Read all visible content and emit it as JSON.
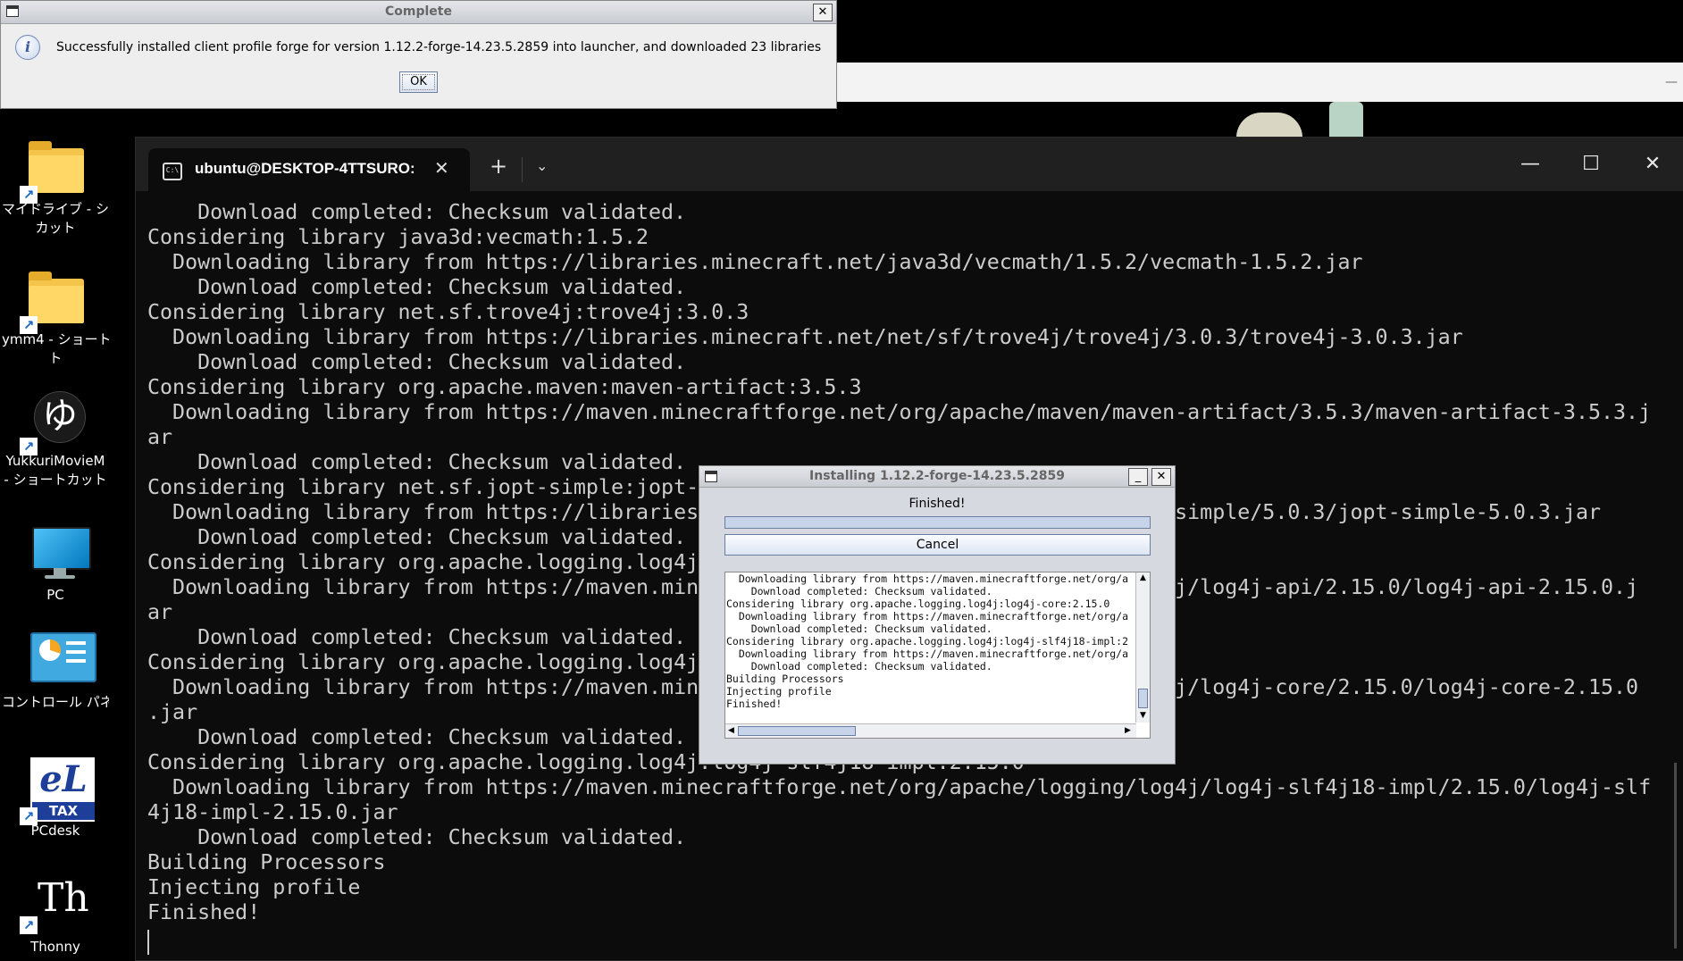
{
  "desktop": {
    "icons": [
      {
        "label1": "マイドライブ - ショ",
        "label2": "カット",
        "icon": "folder-icon"
      },
      {
        "label1": "ymm4 - ショートカ",
        "label2": "ト",
        "icon": "folder-icon"
      },
      {
        "label1": "YukkuriMovieM",
        "label2": "- ショートカット",
        "icon": "yukkuri-app-icon",
        "glyph": "ゆ"
      },
      {
        "label1": "PC",
        "label2": "",
        "icon": "monitor-icon"
      },
      {
        "label1": "コントロール パネ",
        "label2": "",
        "icon": "control-panel-icon"
      },
      {
        "label1": "PCdesk",
        "label2": "",
        "icon": "etax-icon",
        "glyph": "eL",
        "glyph2": "TAX"
      },
      {
        "label1": "Thonny",
        "label2": "",
        "icon": "thonny-icon",
        "glyph": "Th"
      }
    ],
    "shortcut_glyph": "↗"
  },
  "terminal": {
    "tab_title": "ubuntu@DESKTOP-4TTSURO:",
    "tab_icon_glyph": "C:\\",
    "tab_close": "✕",
    "new_tab": "+",
    "dropdown": "⌄",
    "minimize": "—",
    "maximize": "☐",
    "close": "✕",
    "lines": [
      "    Download completed: Checksum validated.",
      "Considering library java3d:vecmath:1.5.2",
      "  Downloading library from https://libraries.minecraft.net/java3d/vecmath/1.5.2/vecmath-1.5.2.jar",
      "    Download completed: Checksum validated.",
      "Considering library net.sf.trove4j:trove4j:3.0.3",
      "  Downloading library from https://libraries.minecraft.net/net/sf/trove4j/trove4j/3.0.3/trove4j-3.0.3.jar",
      "    Download completed: Checksum validated.",
      "Considering library org.apache.maven:maven-artifact:3.5.3",
      "  Downloading library from https://maven.minecraftforge.net/org/apache/maven/maven-artifact/3.5.3/maven-artifact-3.5.3.j",
      "ar",
      "    Download completed: Checksum validated.",
      "Considering library net.sf.jopt-simple:jopt-",
      "  Downloading library from https://libraries                                     -simple/5.0.3/jopt-simple-5.0.3.jar",
      "    Download completed: Checksum validated.",
      "Considering library org.apache.logging.log4j",
      "  Downloading library from https://maven.min                                     4j/log4j-api/2.15.0/log4j-api-2.15.0.j",
      "ar",
      "    Download completed: Checksum validated.",
      "Considering library org.apache.logging.log4j",
      "  Downloading library from https://maven.min                                     4j/log4j-core/2.15.0/log4j-core-2.15.0",
      ".jar",
      "    Download completed: Checksum validated.",
      "Considering library org.apache.logging.log4j:log4j-slf4j18-impl:2.15.0",
      "  Downloading library from https://maven.minecraftforge.net/org/apache/logging/log4j/log4j-slf4j18-impl/2.15.0/log4j-slf",
      "4j18-impl-2.15.0.jar",
      "    Download completed: Checksum validated.",
      "Building Processors",
      "Injecting profile",
      "Finished!"
    ]
  },
  "install_dialog": {
    "title": "Installing 1.12.2-forge-14.23.5.2859",
    "status": "Finished!",
    "progress": 1.0,
    "cancel_label": "Cancel",
    "minimize": "_",
    "close": "✕",
    "log_lines": [
      "  Downloading library from https://maven.minecraftforge.net/org/a",
      "    Download completed: Checksum validated.",
      "Considering library org.apache.logging.log4j:log4j-core:2.15.0",
      "  Downloading library from https://maven.minecraftforge.net/org/a",
      "    Download completed: Checksum validated.",
      "Considering library org.apache.logging.log4j:log4j-slf4j18-impl:2",
      "  Downloading library from https://maven.minecraftforge.net/org/a",
      "    Download completed: Checksum validated.",
      "Building Processors",
      "Injecting profile",
      "Finished!"
    ]
  },
  "complete_dialog": {
    "title": "Complete",
    "message": "Successfully installed client profile forge for version 1.12.2-forge-14.23.5.2859 into launcher, and downloaded 23 libraries",
    "ok_label": "OK",
    "close": "✕",
    "info_glyph": "i"
  },
  "background_window": {
    "minimize": "—"
  }
}
